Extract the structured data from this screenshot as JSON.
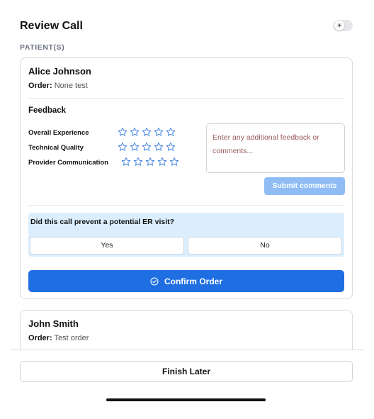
{
  "header": {
    "title": "Review Call",
    "theme_toggle_icon": "sun-icon"
  },
  "section_label": "PATIENT(S)",
  "patients": [
    {
      "name": "Alice Johnson",
      "order_label": "Order:",
      "order_value": "None test",
      "feedback": {
        "title": "Feedback",
        "ratings": [
          {
            "label": "Overall Experience",
            "stars": 0,
            "max": 5
          },
          {
            "label": "Technical Quality",
            "stars": 0,
            "max": 5
          },
          {
            "label": "Provider Communication",
            "stars": 0,
            "max": 5
          }
        ],
        "comment_placeholder": "Enter any additional feedback or comments...",
        "submit_label": "Submit comments"
      },
      "er_question": "Did this call prevent a potential ER visit?",
      "er_yes": "Yes",
      "er_no": "No",
      "confirm_label": "Confirm Order"
    },
    {
      "name": "John Smith",
      "order_label": "Order:",
      "order_value": "Test order"
    }
  ],
  "footer": {
    "finish_label": "Finish Later"
  },
  "colors": {
    "primary": "#1f6fe3",
    "submit_disabled": "#8fbcf5",
    "er_bg": "#dbeefd",
    "star_outline": "#3b7fe0"
  }
}
